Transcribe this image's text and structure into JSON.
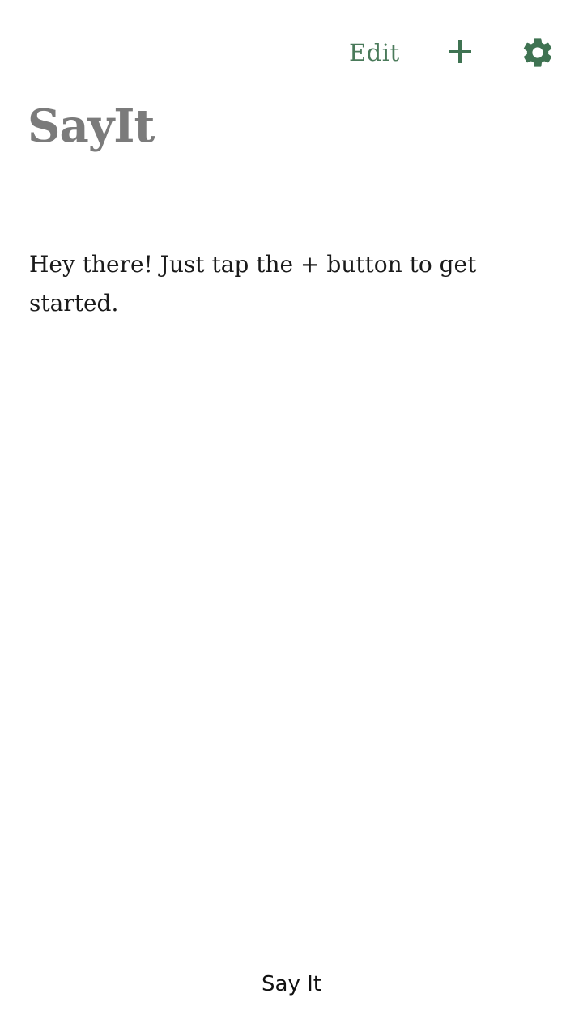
{
  "header": {
    "edit_label": "Edit",
    "add_icon": "plus-icon",
    "settings_icon": "gear-icon",
    "accent_color": "#4a7a5a"
  },
  "main": {
    "title": "SayIt",
    "empty_message": "Hey there! Just tap the + button to get started."
  },
  "footer": {
    "say_it_label": "Say It"
  }
}
